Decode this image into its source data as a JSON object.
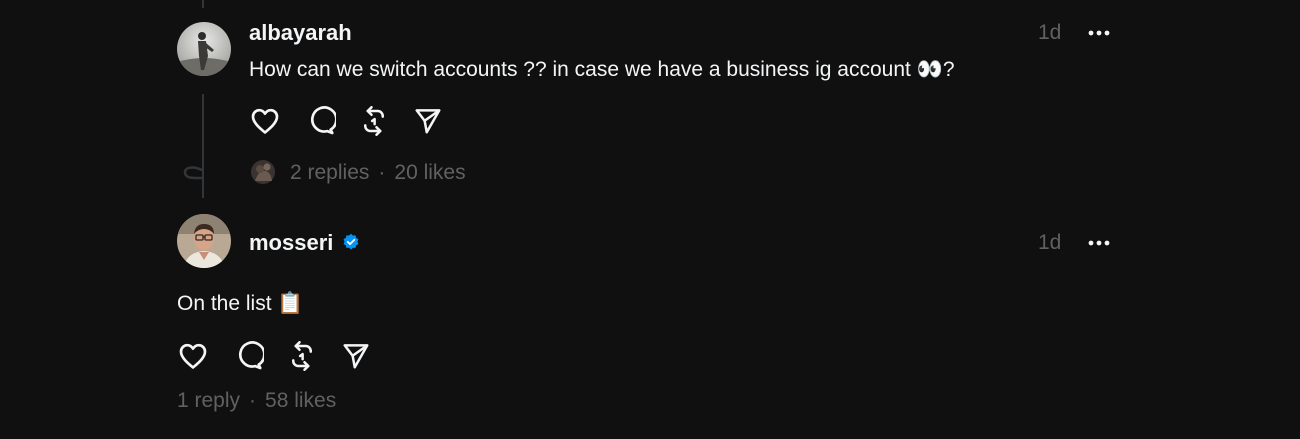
{
  "posts": [
    {
      "username": "albayarah",
      "verified": false,
      "time": "1d",
      "text": "How can we switch accounts ?? in case we have a business ig account 👀?",
      "replies": "2 replies",
      "separator": "·",
      "likes": "20 likes"
    },
    {
      "username": "mosseri",
      "verified": true,
      "time": "1d",
      "text": "On the list 📋",
      "replies": "1 reply",
      "separator": "·",
      "likes": "58 likes"
    }
  ],
  "icons": {
    "like": "heart-icon",
    "reply": "comment-icon",
    "repost": "repost-icon",
    "share": "send-icon",
    "more": "more-icon",
    "verified": "verified-badge-icon"
  },
  "colors": {
    "background": "#101010",
    "text": "#f3f5f7",
    "secondary": "#616161",
    "verified": "#0095f6",
    "thread_line": "#333638"
  }
}
